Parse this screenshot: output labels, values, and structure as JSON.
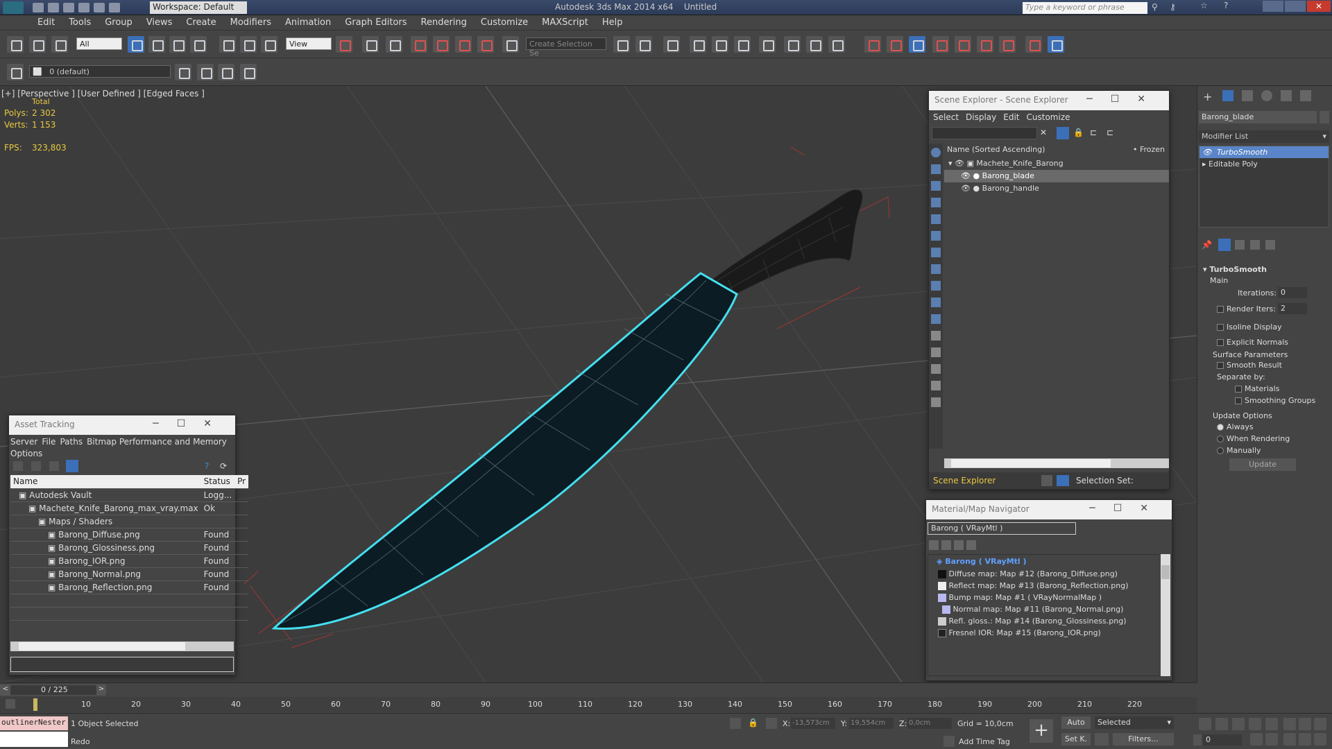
{
  "titlebar": {
    "workspace": "Workspace: Default",
    "app_title": "Autodesk 3ds Max  2014 x64",
    "file": "Untitled",
    "search_placeholder": "Type a keyword or phrase"
  },
  "menu": [
    "Edit",
    "Tools",
    "Group",
    "Views",
    "Create",
    "Modifiers",
    "Animation",
    "Graph Editors",
    "Rendering",
    "Customize",
    "MAXScript",
    "Help"
  ],
  "toolbar": {
    "selection_filter": "All",
    "view_dropdown": "View",
    "named_selection": "Create Selection Se",
    "layer": "0 (default)"
  },
  "viewport": {
    "label": "[+] [Perspective ] [User Defined ] [Edged Faces ]",
    "stats": {
      "total": "Total",
      "polys_label": "Polys:",
      "polys": "2 302",
      "verts_label": "Verts:",
      "verts": "1 153",
      "fps_label": "FPS:",
      "fps": "323,803"
    }
  },
  "scene_explorer": {
    "title": "Scene Explorer - Scene Explorer",
    "menu": [
      "Select",
      "Display",
      "Edit",
      "Customize"
    ],
    "col_name": "Name (Sorted Ascending)",
    "col_frozen": "• Frozen",
    "tree": [
      {
        "name": "Machete_Knife_Barong",
        "level": 0
      },
      {
        "name": "Barong_blade",
        "level": 1,
        "selected": true
      },
      {
        "name": "Barong_handle",
        "level": 1
      }
    ],
    "footer": "Scene Explorer",
    "selection_set": "Selection Set:"
  },
  "asset_tracking": {
    "title": "Asset Tracking",
    "menu": [
      "Server",
      "File",
      "Paths",
      "Bitmap Performance and Memory"
    ],
    "menu2": "Options",
    "columns": [
      "Name",
      "Status",
      "Pr"
    ],
    "rows": [
      {
        "name": "Autodesk Vault",
        "status": "Logg...",
        "indent": 0
      },
      {
        "name": "Machete_Knife_Barong_max_vray.max",
        "status": "Ok",
        "indent": 1
      },
      {
        "name": "Maps / Shaders",
        "status": "",
        "indent": 2
      },
      {
        "name": "Barong_Diffuse.png",
        "status": "Found",
        "indent": 3
      },
      {
        "name": "Barong_Glossiness.png",
        "status": "Found",
        "indent": 3
      },
      {
        "name": "Barong_IOR.png",
        "status": "Found",
        "indent": 3
      },
      {
        "name": "Barong_Normal.png",
        "status": "Found",
        "indent": 3
      },
      {
        "name": "Barong_Reflection.png",
        "status": "Found",
        "indent": 3
      }
    ]
  },
  "material_navigator": {
    "title": "Material/Map Navigator",
    "field": "Barong  ( VRayMtl )",
    "items": [
      {
        "label": "Barong  ( VRayMtl )",
        "root": true
      },
      {
        "label": "Diffuse map: Map #12 (Barong_Diffuse.png)",
        "swatch": "#111111"
      },
      {
        "label": "Reflect map: Map #13 (Barong_Reflection.png)",
        "swatch": "#eeeeee"
      },
      {
        "label": "Bump map: Map #1  ( VRayNormalMap )",
        "swatch": "#b8b8f0"
      },
      {
        "label": "Normal map: Map #11 (Barong_Normal.png)",
        "swatch": "#b8b8f0",
        "indent": true
      },
      {
        "label": "Refl. gloss.: Map #14 (Barong_Glossiness.png)",
        "swatch": "#cccccc"
      },
      {
        "label": "Fresnel IOR: Map #15 (Barong_IOR.png)",
        "swatch": "#222222"
      }
    ]
  },
  "command_panel": {
    "object_name": "Barong_blade",
    "modifier_list": "Modifier List",
    "stack": [
      "TurboSmooth",
      "Editable Poly"
    ],
    "rollout": "TurboSmooth",
    "main": "Main",
    "iterations_label": "Iterations:",
    "iterations": "0",
    "render_iters_label": "Render Iters:",
    "render_iters": "2",
    "isoline": "Isoline Display",
    "explicit": "Explicit Normals",
    "surface_params": "Surface Parameters",
    "smooth_result": "Smooth Result",
    "separate_by": "Separate by:",
    "materials": "Materials",
    "smoothing_groups": "Smoothing Groups",
    "update_options": "Update Options",
    "always": "Always",
    "when_rendering": "When Rendering",
    "manually": "Manually",
    "update_btn": "Update"
  },
  "timeline": {
    "frame": "0 / 225",
    "ticks": [
      "10",
      "20",
      "30",
      "40",
      "50",
      "60",
      "70",
      "80",
      "90",
      "100",
      "110",
      "120",
      "130",
      "140",
      "150",
      "160",
      "170",
      "180",
      "190",
      "200",
      "210",
      "220"
    ]
  },
  "status": {
    "listener": "outlinerNester",
    "selected": "1 Object Selected",
    "prompt": "Redo",
    "x_label": "X:",
    "x": "-13,573cm",
    "y_label": "Y:",
    "y": "19,554cm",
    "z_label": "Z:",
    "z": "0,0cm",
    "grid": "Grid = 10,0cm",
    "add_time_tag": "Add Time Tag",
    "auto": "Auto",
    "set_key": "Set K.",
    "key_mode": "Selected",
    "filters": "Filters...",
    "frame_field": "0"
  },
  "colors": {
    "selection": "#44e0f0",
    "accent_blue": "#3b6fb8",
    "stat_yellow": "#e8c840"
  }
}
